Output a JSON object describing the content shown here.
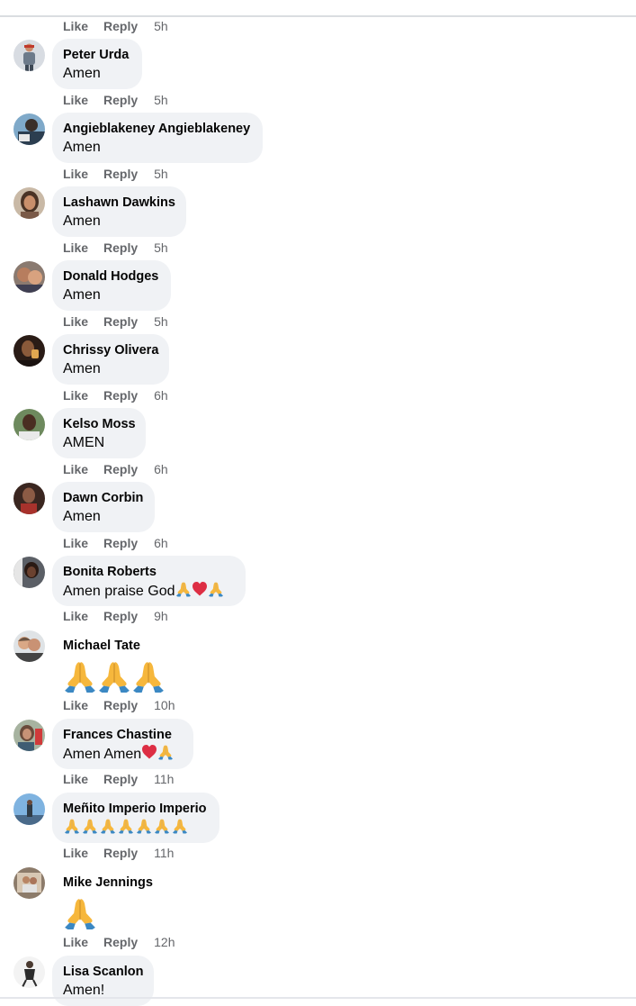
{
  "labels": {
    "like": "Like",
    "reply": "Reply"
  },
  "top_actions": {
    "time": "5h"
  },
  "comments": [
    {
      "author": "Peter Urda",
      "text": "Amen",
      "time": "5h"
    },
    {
      "author": "Angieblakeney Angieblakeney",
      "text": "Amen",
      "time": "5h"
    },
    {
      "author": "Lashawn Dawkins",
      "text": "Amen",
      "time": "5h"
    },
    {
      "author": "Donald Hodges",
      "text": "Amen",
      "time": "5h"
    },
    {
      "author": "Chrissy Olivera",
      "text": "Amen",
      "time": "6h"
    },
    {
      "author": "Kelso Moss",
      "text": "AMEN",
      "time": "6h"
    },
    {
      "author": "Dawn Corbin",
      "text": "Amen",
      "time": "6h"
    },
    {
      "author": "Bonita Roberts",
      "text": "Amen praise God",
      "time": "9h"
    },
    {
      "author": "Michael Tate",
      "text": "",
      "time": "10h"
    },
    {
      "author": "Frances Chastine",
      "text": "Amen Amen",
      "time": "11h"
    },
    {
      "author": "Meñito Imperio Imperio",
      "text": "",
      "time": "11h"
    },
    {
      "author": "Mike Jennings",
      "text": "",
      "time": "12h"
    },
    {
      "author": "Lisa Scanlon",
      "text": "Amen!"
    }
  ],
  "icons": {
    "praying_hands": "folded-hands-emoji",
    "heart": "red-heart-emoji"
  },
  "colors": {
    "bubble": "#f0f2f5",
    "meta_text": "#65676b",
    "primary_text": "#050505"
  }
}
